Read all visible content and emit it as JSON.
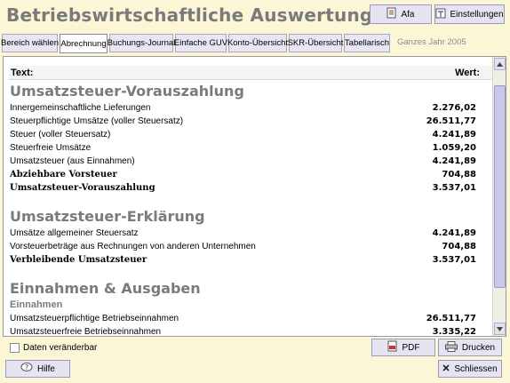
{
  "app": {
    "title": "Betriebswirtschaftliche Auswertung"
  },
  "toolbar": {
    "afa_label": "Afa",
    "settings_label": "Einstellungen"
  },
  "tabs": [
    {
      "label": "Bereich wählen"
    },
    {
      "label": "Abrechnung",
      "active": true
    },
    {
      "label": "Buchungs-Journal"
    },
    {
      "label": "Einfache GUV"
    },
    {
      "label": "Konto-Übersicht"
    },
    {
      "label": "SKR-Übersicht"
    },
    {
      "label": "Tabellarisch"
    }
  ],
  "period": "Ganzes Jahr 2005",
  "columns": {
    "text": "Text:",
    "value": "Wert:"
  },
  "sections": [
    {
      "title": "Umsatzsteuer-Vorauszahlung",
      "rows": [
        {
          "label": "Innergemeinschaftliche Lieferungen",
          "value": "2.276,02"
        },
        {
          "label": "Steuerpflichtige Umsätze (voller Steuersatz)",
          "value": "26.511,77"
        },
        {
          "label": "Steuer (voller Steuersatz)",
          "value": "4.241,89"
        },
        {
          "label": "Steuerfreie Umsätze",
          "value": "1.059,20"
        },
        {
          "label": "Umsatzsteuer (aus Einnahmen)",
          "value": "4.241,89"
        },
        {
          "label": "Abziehbare Vorsteuer",
          "value": "704,88",
          "bold": true
        },
        {
          "label": "Umsatzsteuer-Vorauszahlung",
          "value": "3.537,01",
          "bold": true
        }
      ]
    },
    {
      "title": "Umsatzsteuer-Erklärung",
      "rows": [
        {
          "label": "Umsätze allgemeiner Steuersatz",
          "value": "4.241,89"
        },
        {
          "label": "Vorsteuerbeträge aus Rechnungen von anderen Unternehmen",
          "value": "704,88"
        },
        {
          "label": "Verbleibende Umsatzsteuer",
          "value": "3.537,01",
          "bold": true
        }
      ]
    },
    {
      "title": "Einnahmen & Ausgaben",
      "subtitle": "Einnahmen",
      "rows": [
        {
          "label": "Umsatzsteuerpflichtige Betriebseinnahmen",
          "value": "26.511,77"
        },
        {
          "label": "Umsatzsteuerfreie Betriebseinnahmen",
          "value": "3.335,22"
        }
      ]
    }
  ],
  "footer": {
    "checkbox_label": "Daten veränderbar",
    "pdf_label": "PDF",
    "print_label": "Drucken",
    "help_label": "Hilfe",
    "close_label": "Schliessen"
  },
  "colors": {
    "background": "#fbf6d6",
    "button": "#e6e4f3",
    "section_title": "#7b7b7b"
  }
}
